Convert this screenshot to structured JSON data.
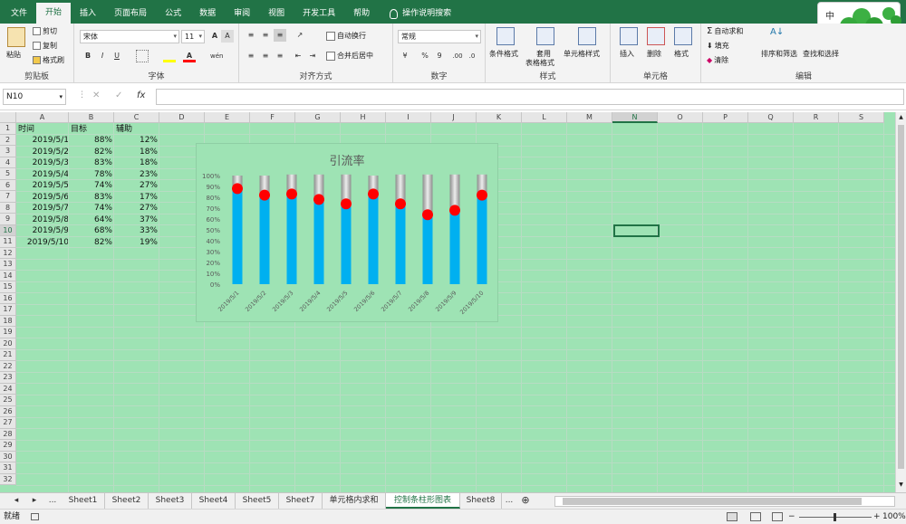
{
  "menu": {
    "items": [
      "文件",
      "开始",
      "插入",
      "页面布局",
      "公式",
      "数据",
      "审阅",
      "视图",
      "开发工具",
      "帮助"
    ],
    "search_label": "操作说明搜索"
  },
  "ribbon": {
    "clipboard": {
      "paste": "粘贴",
      "cut": "剪切",
      "copy": "复制",
      "format_painter": "格式刷",
      "label": "剪贴板"
    },
    "font": {
      "name": "宋体",
      "size": "11",
      "bold": "B",
      "italic": "I",
      "underline": "U",
      "label": "字体",
      "font_color_glyph": "A",
      "grow": "A",
      "shrink": "A",
      "wen": "wén"
    },
    "align": {
      "wrap": "自动换行",
      "merge": "合并后居中",
      "label": "对齐方式"
    },
    "number": {
      "format": "常规",
      "percent": "%",
      "comma": "9",
      "inc": ".00",
      "dec": ".0",
      "label": "数字"
    },
    "styles": {
      "cond": "条件格式",
      "table1": "套用",
      "table2": "表格格式",
      "cell": "单元格样式",
      "label": "样式"
    },
    "cells": {
      "insert": "插入",
      "delete": "删除",
      "format": "格式",
      "label": "单元格"
    },
    "editing": {
      "autosum": "自动求和",
      "fill": "填充",
      "clear": "清除",
      "sort": "排序和筛选",
      "find": "查找和选择",
      "label": "编辑"
    }
  },
  "overlay": {
    "ime": "中"
  },
  "formula": {
    "namebox": "N10",
    "cancel": "✕",
    "enter": "✓",
    "fx": "fx",
    "content": ""
  },
  "columns": [
    "A",
    "B",
    "C",
    "D",
    "E",
    "F",
    "G",
    "H",
    "I",
    "J",
    "K",
    "L",
    "M",
    "N",
    "O",
    "P",
    "Q",
    "R",
    "S"
  ],
  "rows": [
    "1",
    "2",
    "3",
    "4",
    "5",
    "6",
    "7",
    "8",
    "9",
    "10",
    "11",
    "12",
    "13",
    "14",
    "15",
    "16",
    "17",
    "18",
    "19",
    "20",
    "21",
    "22",
    "23",
    "24",
    "25",
    "26",
    "27",
    "28",
    "29",
    "30",
    "31",
    "32"
  ],
  "table": {
    "headers": [
      "时间",
      "目标",
      "辅助"
    ],
    "rows": [
      [
        "2019/5/1",
        "88%",
        "12%"
      ],
      [
        "2019/5/2",
        "82%",
        "18%"
      ],
      [
        "2019/5/3",
        "83%",
        "18%"
      ],
      [
        "2019/5/4",
        "78%",
        "23%"
      ],
      [
        "2019/5/5",
        "74%",
        "27%"
      ],
      [
        "2019/5/6",
        "83%",
        "17%"
      ],
      [
        "2019/5/7",
        "74%",
        "27%"
      ],
      [
        "2019/5/8",
        "64%",
        "37%"
      ],
      [
        "2019/5/9",
        "68%",
        "33%"
      ],
      [
        "2019/5/10",
        "82%",
        "19%"
      ]
    ]
  },
  "chart_data": {
    "type": "bar",
    "title": "引流率",
    "categories": [
      "2019/5/1",
      "2019/5/2",
      "2019/5/3",
      "2019/5/4",
      "2019/5/5",
      "2019/5/6",
      "2019/5/7",
      "2019/5/8",
      "2019/5/9",
      "2019/5/10"
    ],
    "series": [
      {
        "name": "目标",
        "values": [
          0.88,
          0.82,
          0.83,
          0.78,
          0.74,
          0.83,
          0.74,
          0.64,
          0.68,
          0.82
        ],
        "color": "#00b0f0"
      },
      {
        "name": "辅助",
        "values": [
          0.12,
          0.18,
          0.18,
          0.23,
          0.27,
          0.17,
          0.27,
          0.37,
          0.33,
          0.19
        ],
        "color": "#a6a6a6"
      }
    ],
    "stacked": true,
    "marker_color": "#ff0000",
    "ylim": [
      0,
      1
    ],
    "yticks": [
      "0%",
      "10%",
      "20%",
      "30%",
      "40%",
      "50%",
      "60%",
      "70%",
      "80%",
      "90%",
      "100%"
    ],
    "grid": false,
    "legend": "none"
  },
  "sheets": [
    "Sheet1",
    "Sheet2",
    "Sheet3",
    "Sheet4",
    "Sheet5",
    "Sheet7",
    "单元格内求和",
    "控制条柱形图表",
    "Sheet8"
  ],
  "active_sheet": "控制条柱形图表",
  "status": {
    "ready": "就绪",
    "zoom": "100%"
  },
  "colors": {
    "excel_green": "#217346",
    "sheet_bg": "#9ee3b4",
    "bar": "#00b0f0",
    "track": "#a6a6a6",
    "marker": "#ff0000"
  }
}
